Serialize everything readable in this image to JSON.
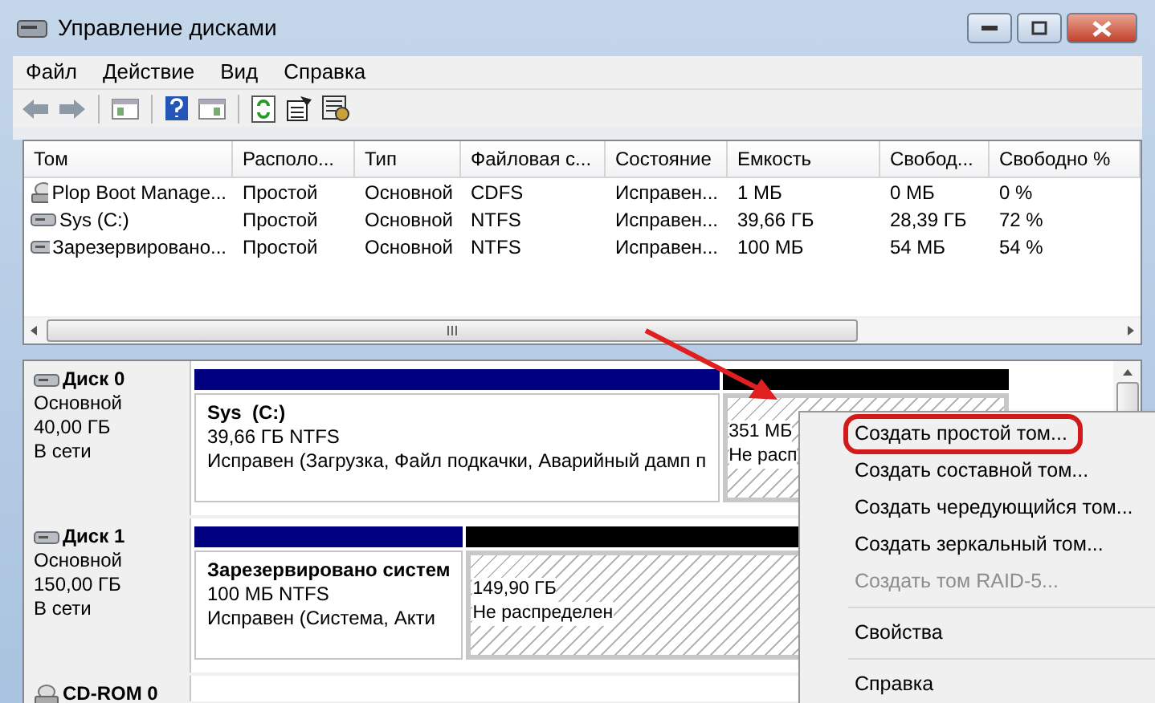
{
  "window": {
    "title": "Управление дисками"
  },
  "menu": [
    "Файл",
    "Действие",
    "Вид",
    "Справка"
  ],
  "volumes": {
    "columns": [
      "Том",
      "Располо...",
      "Тип",
      "Файловая с...",
      "Состояние",
      "Емкость",
      "Свобод...",
      "Свободно %"
    ],
    "rows": [
      {
        "kind": "cd",
        "cells": [
          "Plop Boot Manage...",
          "Простой",
          "Основной",
          "CDFS",
          "Исправен...",
          "1 МБ",
          "0 МБ",
          "0 %"
        ]
      },
      {
        "kind": "disk",
        "cells": [
          "Sys (C:)",
          "Простой",
          "Основной",
          "NTFS",
          "Исправен...",
          "39,66 ГБ",
          "28,39 ГБ",
          "72 %"
        ]
      },
      {
        "kind": "disk",
        "cells": [
          "Зарезервировано...",
          "Простой",
          "Основной",
          "NTFS",
          "Исправен...",
          "100 МБ",
          "54 МБ",
          "54 %"
        ]
      }
    ]
  },
  "disks": [
    {
      "kind": "disk",
      "name": "Диск 0",
      "lines": [
        "Основной",
        "40,00 ГБ",
        "В сети"
      ],
      "partitions": [
        {
          "kind": "primary",
          "title": "Sys  (C:)",
          "lines": [
            "39,66 ГБ NTFS",
            "Исправен (Загрузка, Файл подкачки, Аварийный дамп п"
          ]
        },
        {
          "kind": "unallocated",
          "lines": [
            "351 МБ",
            "Не расп"
          ]
        }
      ]
    },
    {
      "kind": "disk",
      "name": "Диск 1",
      "lines": [
        "Основной",
        "150,00 ГБ",
        "В сети"
      ],
      "partitions": [
        {
          "kind": "primary",
          "title": "Зарезервировано систем",
          "lines": [
            "100 МБ NTFS",
            "Исправен (Система, Акти"
          ]
        },
        {
          "kind": "unallocated",
          "lines": [
            "149,90 ГБ",
            "Не распределен"
          ]
        }
      ]
    },
    {
      "kind": "cd",
      "name": "CD-ROM 0"
    }
  ],
  "context_menu": {
    "items": [
      {
        "kind": "item",
        "label": "Создать простой том...",
        "disabled": false,
        "selected": true
      },
      {
        "kind": "item",
        "label": "Создать составной том...",
        "disabled": false,
        "selected": false
      },
      {
        "kind": "item",
        "label": "Создать чередующийся том...",
        "disabled": false,
        "selected": false
      },
      {
        "kind": "item",
        "label": "Создать зеркальный том...",
        "disabled": false,
        "selected": false
      },
      {
        "kind": "item",
        "label": "Создать том RAID-5...",
        "disabled": true,
        "selected": false
      },
      {
        "kind": "separator"
      },
      {
        "kind": "item",
        "label": "Свойства",
        "disabled": false,
        "selected": false
      },
      {
        "kind": "separator"
      },
      {
        "kind": "item",
        "label": "Справка",
        "disabled": false,
        "selected": false
      }
    ]
  }
}
